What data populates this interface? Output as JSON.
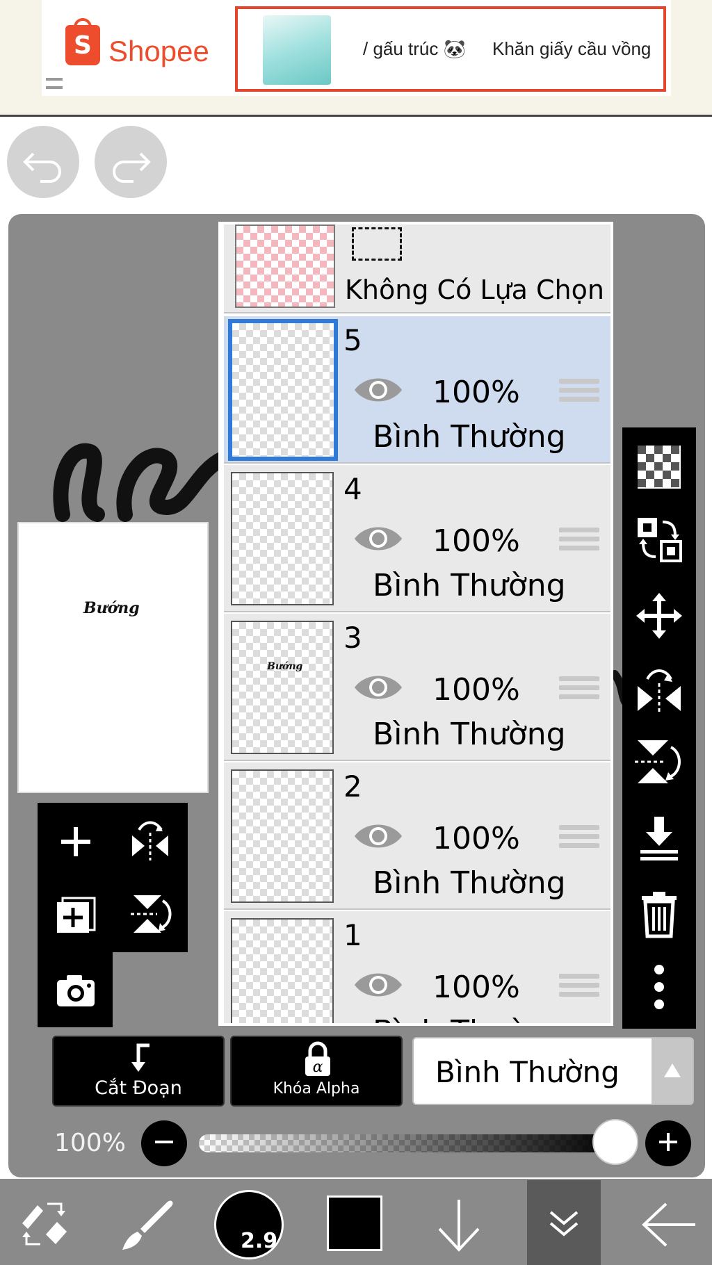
{
  "ad": {
    "brand": "Shopee",
    "product_text_left": "/ gấu trúc 🐼",
    "product_text_right": "Khăn giấy cầu vồng"
  },
  "layers_panel": {
    "selection_label": "Không Có Lựa Chọn",
    "layers": [
      {
        "number": "5",
        "opacity": "100%",
        "blend": "Bình Thường",
        "selected": true
      },
      {
        "number": "4",
        "opacity": "100%",
        "blend": "Bình Thường",
        "selected": false
      },
      {
        "number": "3",
        "opacity": "100%",
        "blend": "Bình Thường",
        "selected": false
      },
      {
        "number": "2",
        "opacity": "100%",
        "blend": "Bình Thường",
        "selected": false
      },
      {
        "number": "1",
        "opacity": "100%",
        "blend": "Bình Thường",
        "selected": false
      }
    ]
  },
  "preview": {
    "script_text": "Bướng"
  },
  "bottom_controls": {
    "clip_label": "Cắt Đoạn",
    "alpha_lock_label": "Khóa Alpha",
    "blend_mode": "Bình Thường",
    "opacity_label": "100%",
    "opacity_value": 1.0
  },
  "toolbar": {
    "brush_size": "2.9"
  },
  "colors": {
    "shopee": "#ee4d2d",
    "selected_layer": "#cfdcef",
    "selected_border": "#2f7ad9",
    "workspace": "#8a8a8a"
  }
}
